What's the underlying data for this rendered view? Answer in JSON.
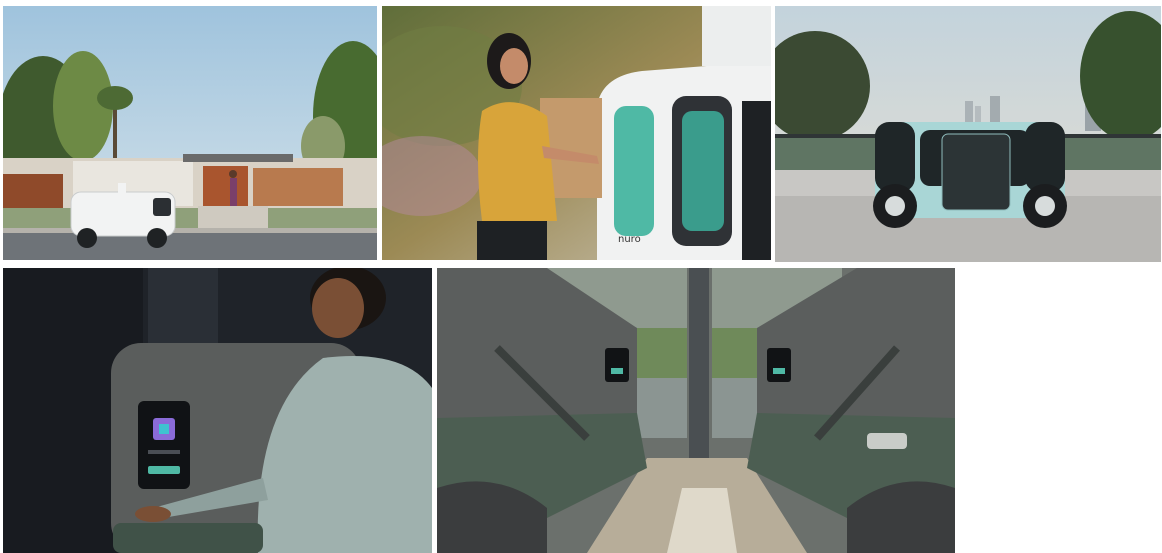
{
  "photos": [
    {
      "subject": "delivery-robot-street"
    },
    {
      "subject": "woman-retrieving-groceries"
    },
    {
      "subject": "robotaxi-parked"
    },
    {
      "subject": "rider-using-cabin-touchscreen"
    },
    {
      "subject": "robotaxi-interior-seats"
    }
  ],
  "vehicle_marking": "nuro",
  "colors": {
    "sky": "#b9d4e6",
    "robot_white": "#f2f3f3",
    "teal": "#4fb9a5",
    "mint_body": "#a9d6d6",
    "cabin_gray": "#5a5d5c",
    "seat_green": "#4c5e52"
  }
}
